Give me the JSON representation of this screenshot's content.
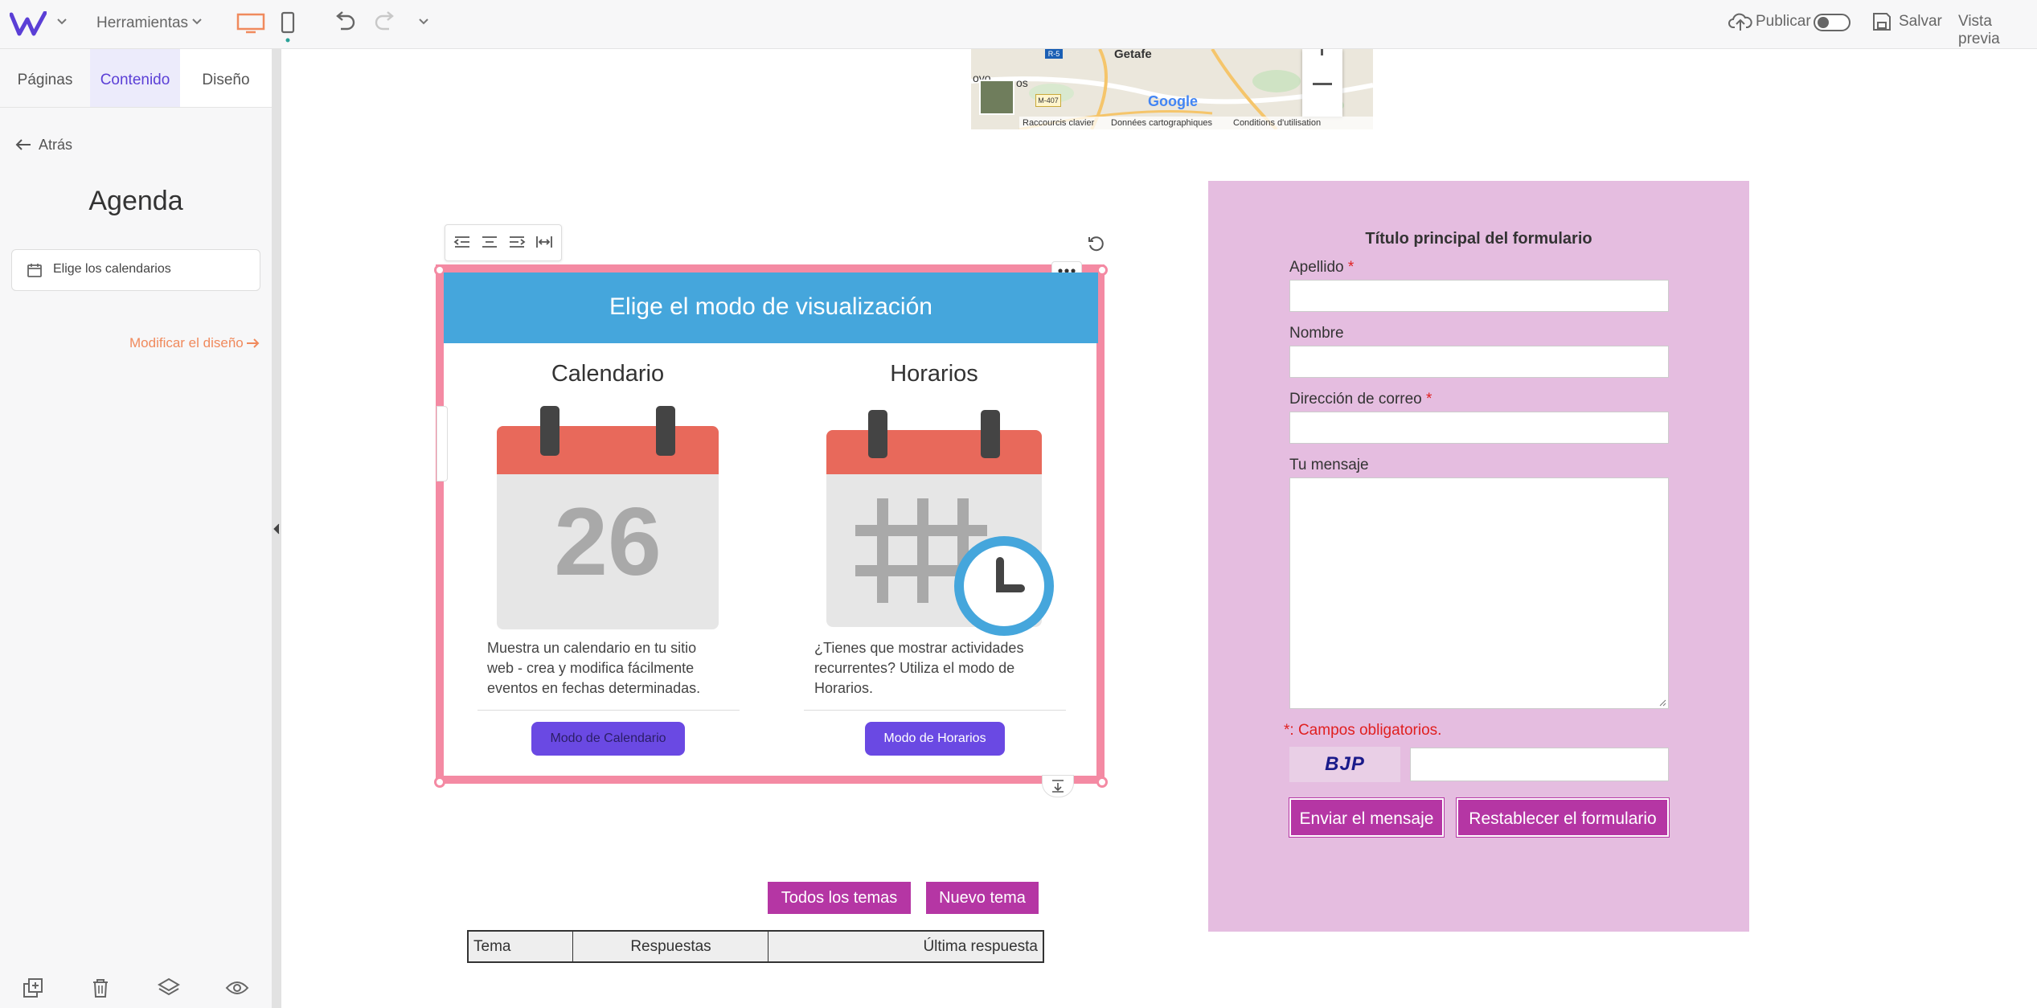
{
  "topbar": {
    "tools_label": "Herramientas",
    "publish_label": "Publicar",
    "save_label": "Salvar",
    "preview_label": "Vista previa"
  },
  "sidebar": {
    "tabs": [
      {
        "label": "Páginas"
      },
      {
        "label": "Contenido"
      },
      {
        "label": "Diseño"
      }
    ],
    "back_label": "Atrás",
    "title": "Agenda",
    "choose_calendars_label": "Elige los calendarios",
    "modify_design_label": "Modificar el diseño"
  },
  "map": {
    "place_getafe": "Getafe",
    "road_r5": "R-5",
    "road_m407": "M-407",
    "place_partial": "oyo",
    "place_partial2": "os",
    "google_logo": "Google",
    "keyboard_shortcuts": "Raccourcis clavier",
    "map_data": "Données cartographiques",
    "terms": "Conditions d'utilisation"
  },
  "agenda_widget": {
    "header": "Elige el modo de visualización",
    "calendar": {
      "title": "Calendario",
      "day": "26",
      "description": "Muestra un calendario en tu sitio web - crea y modifica fácilmente eventos en fechas determinadas.",
      "button": "Modo de Calendario"
    },
    "schedule": {
      "title": "Horarios",
      "description": "¿Tienes que mostrar actividades recurrentes? Utiliza el modo de Horarios.",
      "button": "Modo de Horarios"
    }
  },
  "forum": {
    "all_topics_button": "Todos los temas",
    "new_topic_button": "Nuevo tema",
    "columns": [
      "Tema",
      "Respuestas",
      "Última respuesta"
    ]
  },
  "form": {
    "title": "Título principal del formulario",
    "fields": [
      {
        "label": "Apellido",
        "required": "*"
      },
      {
        "label": "Nombre",
        "required": ""
      },
      {
        "label": "Dirección de correo",
        "required": "*"
      },
      {
        "label": "Tu mensaje",
        "required": ""
      }
    ],
    "required_note": "*: Campos obligatorios.",
    "captcha_text": "BJP",
    "send_button": "Enviar el mensaje",
    "reset_button": "Restablecer el formulario"
  },
  "colors": {
    "accent": "#5b3fd6",
    "orange": "#f08a5d",
    "header_blue": "#45a6dc",
    "selection_pink": "#f48aa3",
    "form_bg": "#e5bde0",
    "form_button": "#b536a4"
  },
  "icons": [
    "logo-w-icon",
    "chevron-down-icon",
    "desktop-icon",
    "mobile-icon",
    "undo-icon",
    "redo-icon",
    "cloud-upload-icon",
    "toggle-icon",
    "save-icon",
    "arrow-left-icon",
    "calendar-icon",
    "arrow-right-icon",
    "duplicate-icon",
    "trash-icon",
    "layers-icon",
    "eye-icon",
    "align-left-icon",
    "align-center-icon",
    "align-right-icon",
    "stretch-icon",
    "reset-icon",
    "more-icon",
    "clock-icon"
  ]
}
